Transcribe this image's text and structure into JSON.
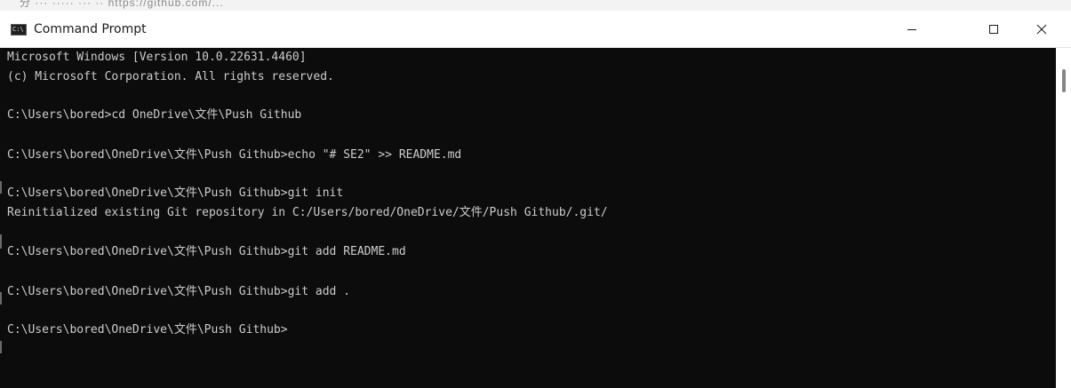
{
  "background_snippet": "分  ···  ·····  ···  ··  https://github.com/...",
  "window": {
    "title": "Command Prompt",
    "app_icon_text": "C:\\"
  },
  "controls": {
    "minimize": "minimize-icon",
    "maximize": "maximize-icon",
    "close": "close-icon"
  },
  "console": {
    "lines": [
      "Microsoft Windows [Version 10.0.22631.4460]",
      "(c) Microsoft Corporation. All rights reserved.",
      "C:\\Users\\bored>cd OneDrive\\文件\\Push Github",
      "C:\\Users\\bored\\OneDrive\\文件\\Push Github>echo \"# SE2\" >> README.md",
      "C:\\Users\\bored\\OneDrive\\文件\\Push Github>git init",
      "Reinitialized existing Git repository in C:/Users/bored/OneDrive/文件/Push Github/.git/",
      "C:\\Users\\bored\\OneDrive\\文件\\Push Github>git add README.md",
      "C:\\Users\\bored\\OneDrive\\文件\\Push Github>git add .",
      "C:\\Users\\bored\\OneDrive\\文件\\Push Github>"
    ]
  },
  "colors": {
    "console_bg": "#0c0c0c",
    "console_text": "#cccccc",
    "titlebar_bg": "#ffffff"
  }
}
